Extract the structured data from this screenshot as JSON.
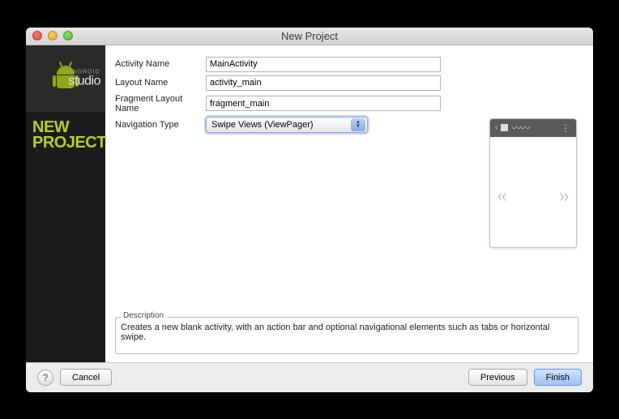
{
  "window": {
    "title": "New Project"
  },
  "sidebar": {
    "brand_small": "ANDROID",
    "brand_big": "studio",
    "heading_line1": "NEW",
    "heading_line2": "PROJECT"
  },
  "form": {
    "activity_name": {
      "label": "Activity Name",
      "value": "MainActivity"
    },
    "layout_name": {
      "label": "Layout Name",
      "value": "activity_main"
    },
    "fragment_layout_name": {
      "label": "Fragment Layout Name",
      "value": "fragment_main"
    },
    "navigation_type": {
      "label": "Navigation Type",
      "selected": "Swipe Views (ViewPager)"
    }
  },
  "preview": {
    "left_chevron": "«",
    "right_chevron": "»"
  },
  "description": {
    "legend": "Description",
    "text": "Creates a new blank activity, with an action bar and optional navigational elements such as tabs or horizontal swipe."
  },
  "footer": {
    "help": "?",
    "cancel": "Cancel",
    "previous": "Previous",
    "finish": "Finish"
  }
}
